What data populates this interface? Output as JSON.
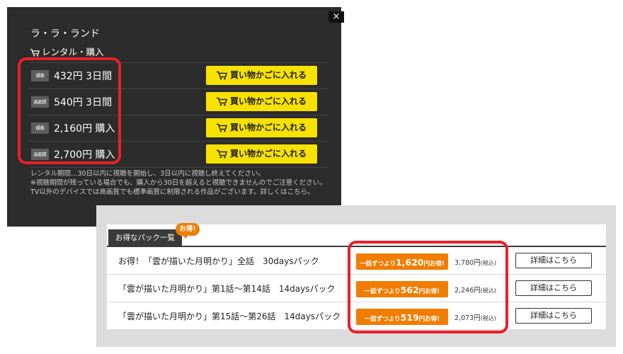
{
  "rental_panel": {
    "close_symbol": "×",
    "title": "ラ・ラ・ランド",
    "section_label": "レンタル・購入",
    "options": [
      {
        "quality": "標準",
        "price": "432円 3日間",
        "button_label": "買い物かごに入れる"
      },
      {
        "quality": "高画質",
        "price": "540円 3日間",
        "button_label": "買い物かごに入れる"
      },
      {
        "quality": "標準",
        "price": "2,160円 購入",
        "button_label": "買い物かごに入れる"
      },
      {
        "quality": "高画質",
        "price": "2,700円 購入",
        "button_label": "買い物かごに入れる"
      }
    ],
    "notes": [
      "レンタル期間…30日以内に視聴を開始し、3日以内に視聴し終えてください。",
      "※視聴期間が残っている場合でも、購入から30日を超えると視聴できませんのでご注意ください。",
      "TV以外のデバイスでは高画質でも標準画質に制限される作品がございます。詳しくはこちら。"
    ],
    "button_color": "#f7e100",
    "background_color": "#2c2c2c"
  },
  "pack_panel": {
    "tab_label": "お得なパック一覧",
    "badge_label": "お得!",
    "packs": [
      {
        "name": "お得！「雲が描いた月明かり」全話　30daysパック",
        "deal_prefix": "一話ずつより",
        "deal_amount": "1,620",
        "deal_suffix": "円お得!",
        "price": "3,780円",
        "tax": "(税込)",
        "detail_label": "詳細はこちら"
      },
      {
        "name": "「雲が描いた月明かり」第1話～第14話　14daysパック",
        "deal_prefix": "一話ずつより",
        "deal_amount": "562",
        "deal_suffix": "円お得!",
        "price": "2,246円",
        "tax": "(税込)",
        "detail_label": "詳細はこちら"
      },
      {
        "name": "「雲が描いた月明かり」第15話～第26話　14daysパック",
        "deal_prefix": "一話ずつより",
        "deal_amount": "519",
        "deal_suffix": "円お得!",
        "price": "2,073円",
        "tax": "(税込)",
        "detail_label": "詳細はこちら"
      }
    ],
    "deal_color": "#f07d00"
  },
  "highlight_color": "#e8202a",
  "icons": [
    "close-icon",
    "cart-icon"
  ]
}
